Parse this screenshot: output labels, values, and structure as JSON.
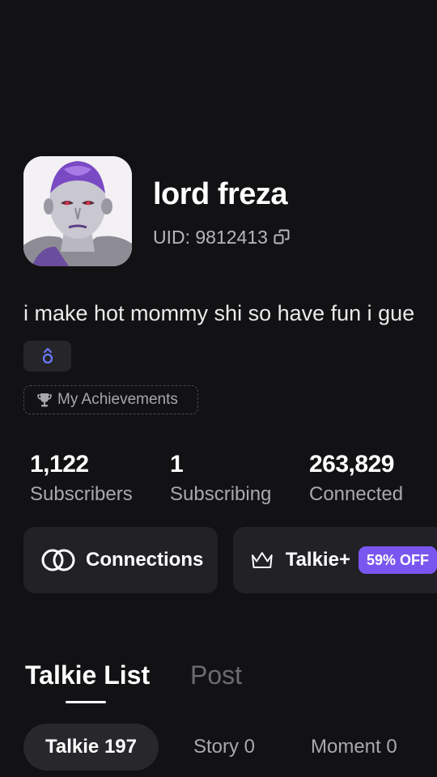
{
  "profile": {
    "name": "lord freza",
    "uid": "UID: 9812413",
    "bio": "i make hot mommy shi so have fun i gue",
    "achievements_label": "My Achievements",
    "badge_icon": "chat-bubble-icon",
    "avatar_icon": "character-avatar"
  },
  "stats": [
    {
      "value": "1,122",
      "label": "Subscribers"
    },
    {
      "value": "1",
      "label": "Subscribing"
    },
    {
      "value": "263,829",
      "label": "Connected"
    }
  ],
  "actions": {
    "connections_label": "Connections",
    "talkie_plus_label": "Talkie+",
    "offer_label": "59% OFF"
  },
  "tabs": [
    {
      "label": "Talkie List",
      "active": true
    },
    {
      "label": "Post",
      "active": false
    }
  ],
  "subtabs": [
    {
      "label": "Talkie 197",
      "active": true
    },
    {
      "label": "Story 0",
      "active": false
    },
    {
      "label": "Moment 0",
      "active": false
    }
  ],
  "colors": {
    "background": "#121113",
    "card": "#222125",
    "accent": "#7a56f0",
    "muted_text": "#a9a8ac"
  }
}
